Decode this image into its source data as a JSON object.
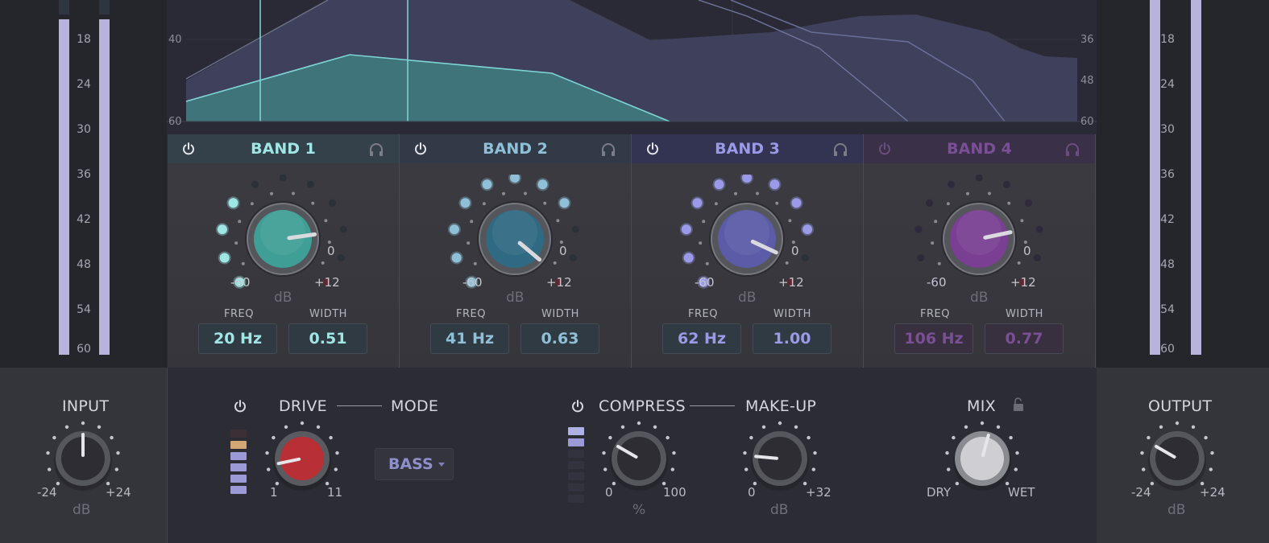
{
  "meters": {
    "left_ticks": [
      "18",
      "24",
      "30",
      "36",
      "42",
      "48",
      "54",
      "60"
    ],
    "right_ticks": [
      "18",
      "24",
      "30",
      "36",
      "42",
      "48",
      "54",
      "60"
    ],
    "bar_color": "#b7b4dc"
  },
  "spectrum": {
    "left_labels": [
      "40",
      "60"
    ],
    "right_labels": [
      "36",
      "48",
      "60"
    ]
  },
  "bands": [
    {
      "title": "BAND 1",
      "freq_label": "FREQ",
      "width_label": "WIDTH",
      "freq": "20 Hz",
      "width": "0.51",
      "knob_min": "-60",
      "knob_zero": "0",
      "knob_max": "+12",
      "knob_unit": "dB",
      "color": "#3f9f96",
      "text_color": "#9fe6e4",
      "header_bg": "#34404a"
    },
    {
      "title": "BAND 2",
      "freq_label": "FREQ",
      "width_label": "WIDTH",
      "freq": "41 Hz",
      "width": "0.63",
      "knob_min": "-60",
      "knob_zero": "0",
      "knob_max": "+12",
      "knob_unit": "dB",
      "color": "#2f6a82",
      "text_color": "#8fc0d8",
      "header_bg": "#323a48"
    },
    {
      "title": "BAND 3",
      "freq_label": "FREQ",
      "width_label": "WIDTH",
      "freq": "62 Hz",
      "width": "1.00",
      "knob_min": "-60",
      "knob_zero": "0",
      "knob_max": "+12",
      "knob_unit": "dB",
      "color": "#5b5ba8",
      "text_color": "#9a9ae8",
      "header_bg": "#333352"
    },
    {
      "title": "BAND 4",
      "freq_label": "FREQ",
      "width_label": "WIDTH",
      "freq": "106 Hz",
      "width": "0.77",
      "knob_min": "-60",
      "knob_zero": "0",
      "knob_max": "+12",
      "knob_unit": "dB",
      "color": "#7a3f92",
      "text_color": "#7a4f96",
      "header_bg": "#3a3047"
    }
  ],
  "input": {
    "title": "INPUT",
    "min": "-24",
    "max": "+24",
    "unit": "dB"
  },
  "drive": {
    "title": "DRIVE",
    "mode_title": "MODE",
    "min": "1",
    "max": "11",
    "mode_value": "BASS"
  },
  "compress": {
    "title": "COMPRESS",
    "makeup_title": "MAKE-UP",
    "comp_min": "0",
    "comp_max": "100",
    "comp_unit": "%",
    "makeup_min": "0",
    "makeup_max": "+32",
    "makeup_unit": "dB"
  },
  "mix": {
    "title": "MIX",
    "dry": "DRY",
    "wet": "WET"
  },
  "output": {
    "title": "OUTPUT",
    "min": "-24",
    "max": "+24",
    "unit": "dB"
  }
}
